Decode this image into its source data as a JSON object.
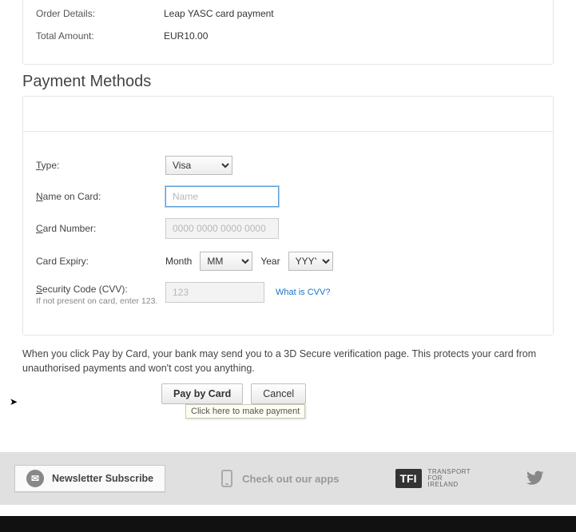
{
  "order": {
    "details_label": "Order Details:",
    "details_value": "Leap YASC card payment",
    "total_label": "Total Amount:",
    "total_value": "EUR10.00"
  },
  "section_title": "Payment Methods",
  "form": {
    "type_label": "Type:",
    "type_selected": "Visa",
    "name_label_pre": "N",
    "name_label_rest": "ame on Card:",
    "name_placeholder": "Name",
    "card_label_pre": "C",
    "card_label_rest": "ard Number:",
    "card_placeholder": "0000 0000 0000 0000",
    "expiry_label": "Card Expiry:",
    "month_label_pre": "M",
    "month_label_rest": "onth",
    "month_selected": "MM",
    "year_label": "Year",
    "year_selected": "YYYY",
    "cvv_label_pre": "S",
    "cvv_label_rest": "ecurity Code (CVV):",
    "cvv_placeholder": "123",
    "cvv_help": "What is CVV?",
    "cvv_hint": "If not present on card, enter 123."
  },
  "notice": "When you click Pay by Card, your bank may send you to a 3D Secure verification page. This protects your card from unauthorised payments and won't cost you anything.",
  "buttons": {
    "pay": "Pay by Card",
    "cancel": "Cancel",
    "tooltip": "Click here to make payment"
  },
  "footer": {
    "newsletter": "Newsletter Subscribe",
    "apps": "Check out our apps",
    "tfi_badge": "TFI",
    "tfi_line1": "Transport",
    "tfi_line2": "for",
    "tfi_line3": "Ireland"
  }
}
